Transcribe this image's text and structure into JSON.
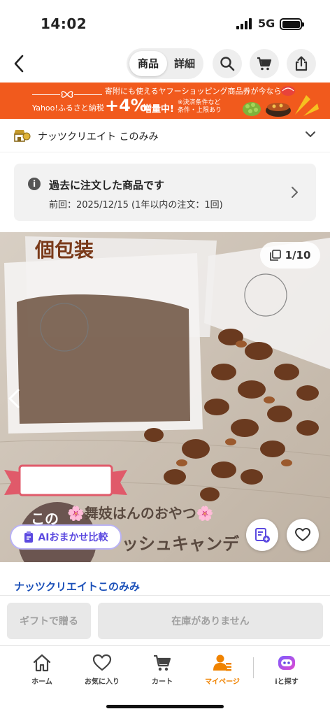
{
  "status": {
    "time": "14:02",
    "network": "5G"
  },
  "nav": {
    "tab_product": "商品",
    "tab_detail": "詳細"
  },
  "promo": {
    "top_text": "寄附にも使えるヤフーショッピング商品券が今なら",
    "brand": "Yahoo!ふるさと納税",
    "plus": "+4%",
    "mid": "増量中!",
    "note_line1": "※決済条件など",
    "note_line2": "条件・上限あり",
    "accent_color": "#f15a1d"
  },
  "shop": {
    "name": "ナッツクリエイト このみみ"
  },
  "past_order": {
    "title": "過去に注文した商品です",
    "detail": "前回：2025/12/15 (1年以内の注文：1回)"
  },
  "hero": {
    "image_counter": "1/10",
    "overlay_kobetsu": "個包装",
    "overlay_maiko": "🌸舞妓はんのおやつ🌸",
    "overlay_candy": "ッシュキャンデ",
    "overlay_circle": "この",
    "ai_compare_label": "AIおまかせ比較"
  },
  "brand_link": "ナッツクリエイトこのみみ",
  "actions": {
    "gift": "ギフトで贈る",
    "out_of_stock": "在庫がありません"
  },
  "tabs": [
    {
      "label": "ホーム",
      "icon": "home-icon"
    },
    {
      "label": "お気に入り",
      "icon": "heart-icon"
    },
    {
      "label": "カート",
      "icon": "cart-icon"
    },
    {
      "label": "マイページ",
      "icon": "mypage-icon"
    },
    {
      "label": "iと探す",
      "icon": "ai-assistant-icon"
    }
  ],
  "colors": {
    "active_tab": "#f08300",
    "link": "#1a4fb8",
    "ai_purple": "#5b49e0"
  }
}
